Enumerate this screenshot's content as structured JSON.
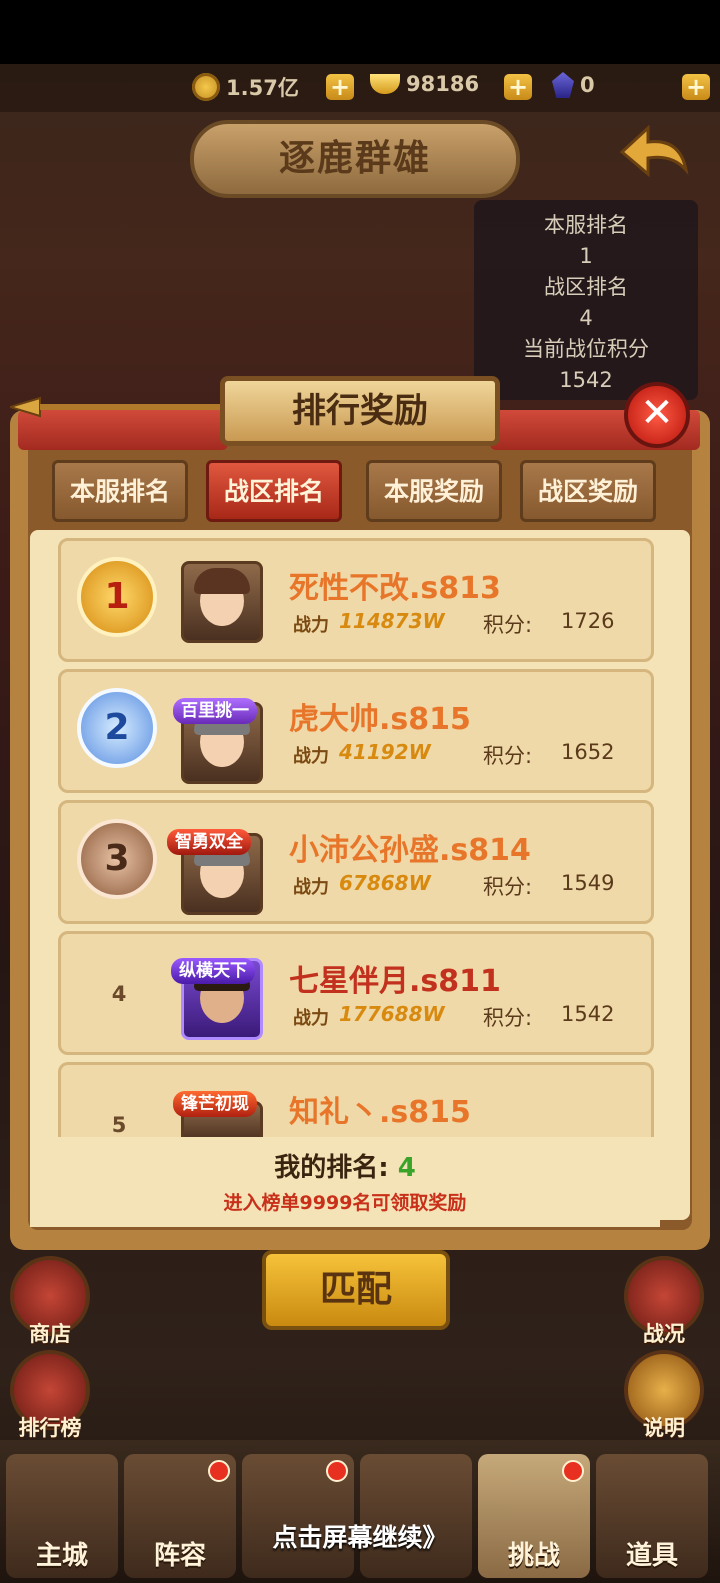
{
  "currency": {
    "gold": "1.57亿",
    "ingots": "98186",
    "gems": "0"
  },
  "page_title": "逐鹿群雄",
  "info_panel": {
    "server_rank_label": "本服排名",
    "server_rank": "1",
    "zone_rank_label": "战区排名",
    "zone_rank": "4",
    "score_label": "当前战位积分",
    "score": "1542"
  },
  "modal": {
    "title": "排行奖励",
    "close_symbol": "✕",
    "tabs": [
      {
        "label": "本服排名",
        "active": false
      },
      {
        "label": "战区排名",
        "active": true
      },
      {
        "label": "本服奖励",
        "active": false
      },
      {
        "label": "战区奖励",
        "active": false
      }
    ],
    "power_label": "战力",
    "score_label": "积分:",
    "rows": [
      {
        "rank": "1",
        "name": "死性不改.s813",
        "power": "114873W",
        "score": "1726",
        "badge": ""
      },
      {
        "rank": "2",
        "name": "虎大帅.s815",
        "power": "41192W",
        "score": "1652",
        "badge": "百里挑一"
      },
      {
        "rank": "3",
        "name": "小沛公孙盛.s814",
        "power": "67868W",
        "score": "1549",
        "badge": "智勇双全"
      },
      {
        "rank": "4",
        "name": "七星伴月.s811",
        "power": "177688W",
        "score": "1542",
        "badge": "纵横天下"
      },
      {
        "rank": "5",
        "name": "知礼丶.s815",
        "power": "",
        "score": "",
        "badge": "锋芒初现"
      }
    ],
    "my_rank_label": "我的排名:",
    "my_rank": "4",
    "reward_hint": "进入榜单9999名可领取奖励"
  },
  "match_button": "匹配",
  "side_buttons": {
    "shop": "商店",
    "leaderboard": "排行榜",
    "battle_report": "战况",
    "help": "说明"
  },
  "bottom_nav": [
    {
      "label": "主城",
      "active": false,
      "dot": false
    },
    {
      "label": "阵容",
      "active": false,
      "dot": true
    },
    {
      "label": "",
      "active": false,
      "dot": true
    },
    {
      "label": "",
      "active": false,
      "dot": false
    },
    {
      "label": "挑战",
      "active": true,
      "dot": true
    },
    {
      "label": "道具",
      "active": false,
      "dot": false
    }
  ],
  "continue_hint": "点击屏幕继续》",
  "colors": {
    "accent_orange": "#e8762a",
    "my_rank_green": "#3aa32a",
    "hint_red": "#c8301a",
    "active_tab": "#c83a26"
  }
}
